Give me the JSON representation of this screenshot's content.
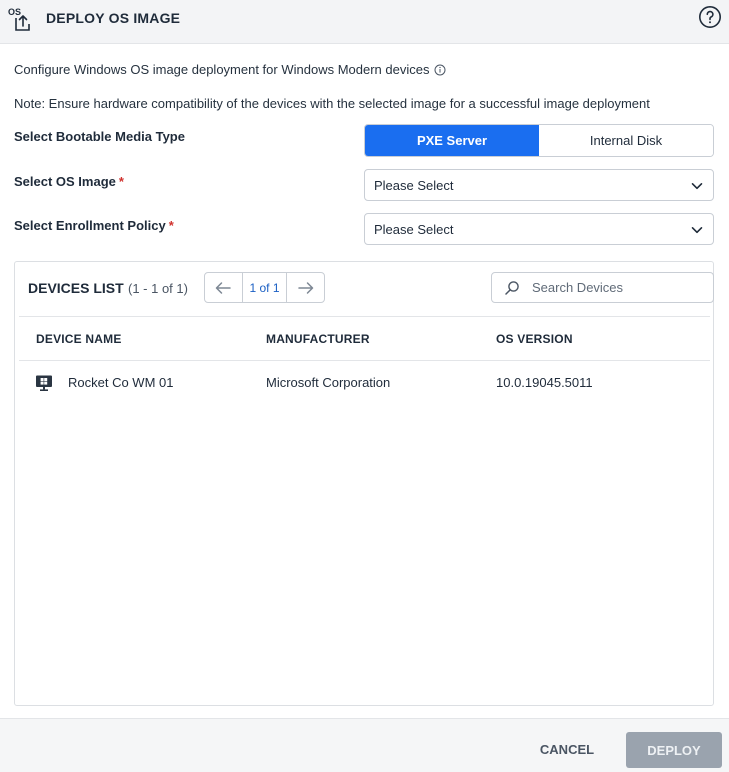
{
  "header": {
    "title": "DEPLOY OS IMAGE",
    "icon_label": "OS"
  },
  "intro": {
    "description": "Configure Windows OS image deployment for Windows Modern devices",
    "note": "Note: Ensure hardware compatibility of the devices with the selected image for a successful image deployment"
  },
  "form": {
    "media_type_label": "Select Bootable Media Type",
    "media_options": [
      "PXE Server",
      "Internal Disk"
    ],
    "media_selected": "PXE Server",
    "os_image_label": "Select OS Image",
    "os_image_value": "Please Select",
    "enrollment_label": "Select Enrollment Policy",
    "enrollment_value": "Please Select",
    "required_mark": "*"
  },
  "devices": {
    "title": "DEVICES LIST",
    "count": "(1 - 1 of 1)",
    "page": "1 of 1",
    "search_placeholder": "Search Devices",
    "columns": [
      "DEVICE NAME",
      "MANUFACTURER",
      "OS VERSION"
    ],
    "rows": [
      {
        "name": "Rocket Co WM 01",
        "manufacturer": "Microsoft Corporation",
        "os_version": "10.0.19045.5011"
      }
    ]
  },
  "footer": {
    "cancel_label": "CANCEL",
    "deploy_label": "DEPLOY"
  },
  "colors": {
    "accent": "#1a6ef0",
    "disabled_button": "#9aa3ae",
    "required": "#d0312d"
  }
}
